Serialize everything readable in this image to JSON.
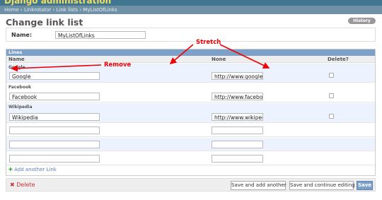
{
  "header": {
    "title": "Django administration"
  },
  "breadcrumbs": {
    "home": "Home",
    "app": "Linkrotator",
    "model": "Link lists",
    "current": "MyListOfLinks",
    "sep": "›"
  },
  "page": {
    "title": "Change link list",
    "history_button": "History"
  },
  "name_field": {
    "label": "Name:",
    "value": "MyListOfLinks"
  },
  "inline": {
    "caption": "Lines",
    "columns": {
      "name": "Name",
      "none": "None",
      "delete": "Delete?"
    },
    "rows": [
      {
        "title": "Google",
        "name": "Google",
        "url": "http://www.google.co",
        "delete": false
      },
      {
        "title": "Facebook",
        "name": "Facebook",
        "url": "http://www.facebook",
        "delete": false
      },
      {
        "title": "Wikipedia",
        "name": "Wikipedia",
        "url": "http://www.wikiped",
        "delete": false
      },
      {
        "name": "",
        "url": ""
      },
      {
        "name": "",
        "url": ""
      },
      {
        "name": "",
        "url": ""
      }
    ],
    "add_another": "Add another Link"
  },
  "submit_row": {
    "delete": "Delete",
    "save_add": "Save and add another",
    "save_continue": "Save and continue editing",
    "save": "Save"
  },
  "annotations": {
    "remove": "Remove",
    "stretch": "Stretch"
  },
  "colors": {
    "header": "#417690",
    "breadcrumbs": "#6f91a5",
    "caption": "#7ca0c7",
    "annotation": "#e00000",
    "title_text": "#f5dd5d"
  }
}
